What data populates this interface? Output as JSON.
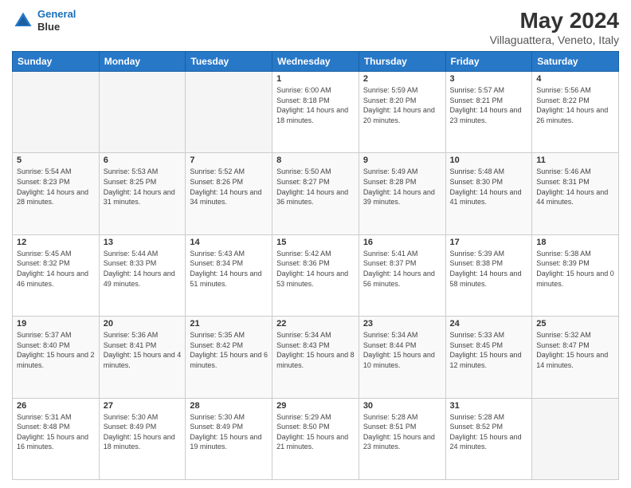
{
  "header": {
    "logo_line1": "General",
    "logo_line2": "Blue",
    "title": "May 2024",
    "subtitle": "Villaguattera, Veneto, Italy"
  },
  "calendar": {
    "days_of_week": [
      "Sunday",
      "Monday",
      "Tuesday",
      "Wednesday",
      "Thursday",
      "Friday",
      "Saturday"
    ],
    "weeks": [
      [
        {
          "day": "",
          "empty": true
        },
        {
          "day": "",
          "empty": true
        },
        {
          "day": "",
          "empty": true
        },
        {
          "day": "1",
          "sunrise": "6:00 AM",
          "sunset": "8:18 PM",
          "daylight": "14 hours and 18 minutes."
        },
        {
          "day": "2",
          "sunrise": "5:59 AM",
          "sunset": "8:20 PM",
          "daylight": "14 hours and 20 minutes."
        },
        {
          "day": "3",
          "sunrise": "5:57 AM",
          "sunset": "8:21 PM",
          "daylight": "14 hours and 23 minutes."
        },
        {
          "day": "4",
          "sunrise": "5:56 AM",
          "sunset": "8:22 PM",
          "daylight": "14 hours and 26 minutes."
        }
      ],
      [
        {
          "day": "5",
          "sunrise": "5:54 AM",
          "sunset": "8:23 PM",
          "daylight": "14 hours and 28 minutes."
        },
        {
          "day": "6",
          "sunrise": "5:53 AM",
          "sunset": "8:25 PM",
          "daylight": "14 hours and 31 minutes."
        },
        {
          "day": "7",
          "sunrise": "5:52 AM",
          "sunset": "8:26 PM",
          "daylight": "14 hours and 34 minutes."
        },
        {
          "day": "8",
          "sunrise": "5:50 AM",
          "sunset": "8:27 PM",
          "daylight": "14 hours and 36 minutes."
        },
        {
          "day": "9",
          "sunrise": "5:49 AM",
          "sunset": "8:28 PM",
          "daylight": "14 hours and 39 minutes."
        },
        {
          "day": "10",
          "sunrise": "5:48 AM",
          "sunset": "8:30 PM",
          "daylight": "14 hours and 41 minutes."
        },
        {
          "day": "11",
          "sunrise": "5:46 AM",
          "sunset": "8:31 PM",
          "daylight": "14 hours and 44 minutes."
        }
      ],
      [
        {
          "day": "12",
          "sunrise": "5:45 AM",
          "sunset": "8:32 PM",
          "daylight": "14 hours and 46 minutes."
        },
        {
          "day": "13",
          "sunrise": "5:44 AM",
          "sunset": "8:33 PM",
          "daylight": "14 hours and 49 minutes."
        },
        {
          "day": "14",
          "sunrise": "5:43 AM",
          "sunset": "8:34 PM",
          "daylight": "14 hours and 51 minutes."
        },
        {
          "day": "15",
          "sunrise": "5:42 AM",
          "sunset": "8:36 PM",
          "daylight": "14 hours and 53 minutes."
        },
        {
          "day": "16",
          "sunrise": "5:41 AM",
          "sunset": "8:37 PM",
          "daylight": "14 hours and 56 minutes."
        },
        {
          "day": "17",
          "sunrise": "5:39 AM",
          "sunset": "8:38 PM",
          "daylight": "14 hours and 58 minutes."
        },
        {
          "day": "18",
          "sunrise": "5:38 AM",
          "sunset": "8:39 PM",
          "daylight": "15 hours and 0 minutes."
        }
      ],
      [
        {
          "day": "19",
          "sunrise": "5:37 AM",
          "sunset": "8:40 PM",
          "daylight": "15 hours and 2 minutes."
        },
        {
          "day": "20",
          "sunrise": "5:36 AM",
          "sunset": "8:41 PM",
          "daylight": "15 hours and 4 minutes."
        },
        {
          "day": "21",
          "sunrise": "5:35 AM",
          "sunset": "8:42 PM",
          "daylight": "15 hours and 6 minutes."
        },
        {
          "day": "22",
          "sunrise": "5:34 AM",
          "sunset": "8:43 PM",
          "daylight": "15 hours and 8 minutes."
        },
        {
          "day": "23",
          "sunrise": "5:34 AM",
          "sunset": "8:44 PM",
          "daylight": "15 hours and 10 minutes."
        },
        {
          "day": "24",
          "sunrise": "5:33 AM",
          "sunset": "8:45 PM",
          "daylight": "15 hours and 12 minutes."
        },
        {
          "day": "25",
          "sunrise": "5:32 AM",
          "sunset": "8:47 PM",
          "daylight": "15 hours and 14 minutes."
        }
      ],
      [
        {
          "day": "26",
          "sunrise": "5:31 AM",
          "sunset": "8:48 PM",
          "daylight": "15 hours and 16 minutes."
        },
        {
          "day": "27",
          "sunrise": "5:30 AM",
          "sunset": "8:49 PM",
          "daylight": "15 hours and 18 minutes."
        },
        {
          "day": "28",
          "sunrise": "5:30 AM",
          "sunset": "8:49 PM",
          "daylight": "15 hours and 19 minutes."
        },
        {
          "day": "29",
          "sunrise": "5:29 AM",
          "sunset": "8:50 PM",
          "daylight": "15 hours and 21 minutes."
        },
        {
          "day": "30",
          "sunrise": "5:28 AM",
          "sunset": "8:51 PM",
          "daylight": "15 hours and 23 minutes."
        },
        {
          "day": "31",
          "sunrise": "5:28 AM",
          "sunset": "8:52 PM",
          "daylight": "15 hours and 24 minutes."
        },
        {
          "day": "",
          "empty": true
        }
      ]
    ]
  }
}
